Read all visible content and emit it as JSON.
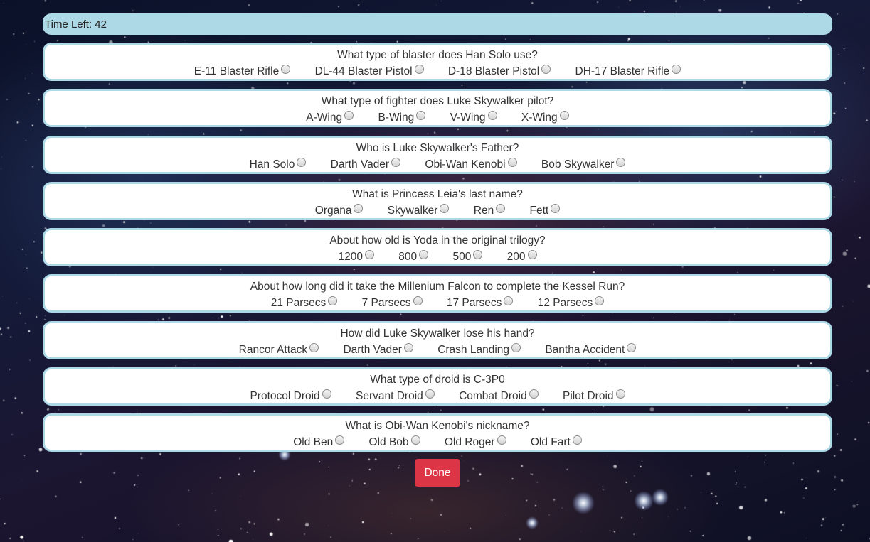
{
  "timer": {
    "label": "Time Left: 42"
  },
  "questions": [
    {
      "question": "What type of blaster does Han Solo use?",
      "answers": [
        "E-11 Blaster Rifle",
        "DL-44 Blaster Pistol",
        "D-18 Blaster Pistol",
        "DH-17 Blaster Rifle"
      ]
    },
    {
      "question": "What type of fighter does Luke Skywalker pilot?",
      "answers": [
        "A-Wing",
        "B-Wing",
        "V-Wing",
        "X-Wing"
      ]
    },
    {
      "question": "Who is Luke Skywalker's Father?",
      "answers": [
        "Han Solo",
        "Darth Vader",
        "Obi-Wan Kenobi",
        "Bob Skywalker"
      ]
    },
    {
      "question": "What is Princess Leia's last name?",
      "answers": [
        "Organa",
        "Skywalker",
        "Ren",
        "Fett"
      ]
    },
    {
      "question": "About how old is Yoda in the original trilogy?",
      "answers": [
        "1200",
        "800",
        "500",
        "200"
      ]
    },
    {
      "question": "About how long did it take the Millenium Falcon to complete the Kessel Run?",
      "answers": [
        "21 Parsecs",
        "7 Parsecs",
        "17 Parsecs",
        "12 Parsecs"
      ]
    },
    {
      "question": "How did Luke Skywalker lose his hand?",
      "answers": [
        "Rancor Attack",
        "Darth Vader",
        "Crash Landing",
        "Bantha Accident"
      ]
    },
    {
      "question": "What type of droid is C-3P0",
      "answers": [
        "Protocol Droid",
        "Servant Droid",
        "Combat Droid",
        "Pilot Droid"
      ]
    },
    {
      "question": "What is Obi-Wan Kenobi's nickname?",
      "answers": [
        "Old Ben",
        "Old Bob",
        "Old Roger",
        "Old Fart"
      ]
    }
  ],
  "done_button": {
    "label": "Done"
  },
  "colors": {
    "timer_bar": "#add8e6",
    "card_border": "#add8e6",
    "done_button": "#dc3545"
  },
  "background": {
    "icon": "starfield-background"
  }
}
